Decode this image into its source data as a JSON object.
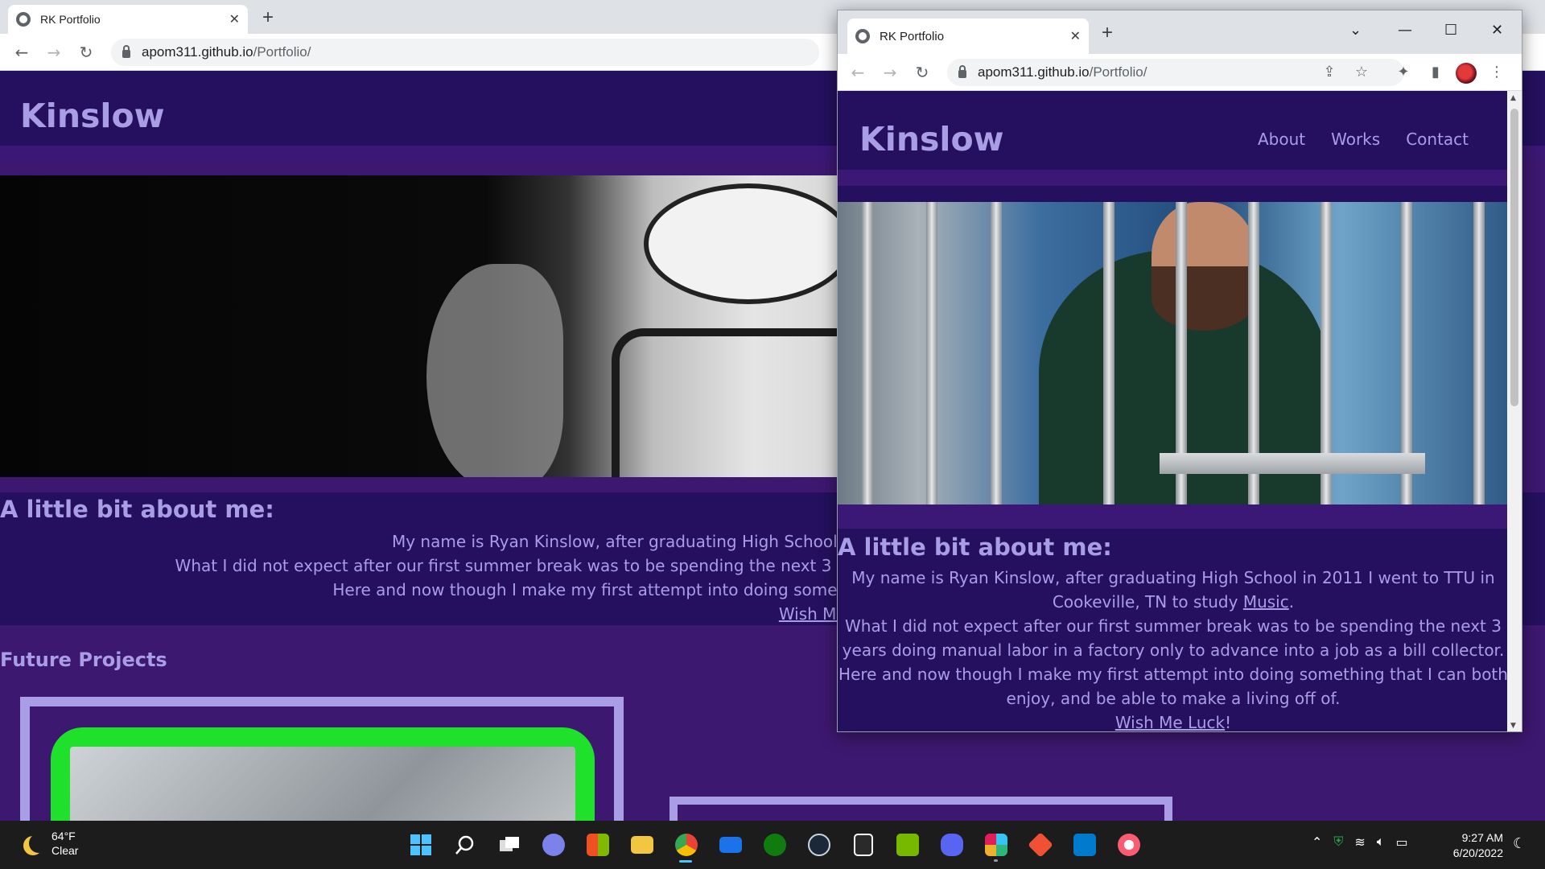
{
  "background_browser": {
    "tab_title": "RK Portfolio",
    "tab_close": "✕",
    "new_tab": "+",
    "url_host": "apom311.github.io",
    "url_path": "/Portfolio/",
    "site": {
      "logo": "Kinslow",
      "about_heading": "A little bit about me:",
      "about_line1": "My name is Ryan Kinslow, after graduating High School in 2011 I went to TTU in Cookeville, TN to study Music.",
      "about_line2": "What I did not expect after our first summer break was to be spending the next 3 years doing manual labor in a factory only to advance into a job as a bill collector.",
      "about_line3": "Here and now though I make my first attempt into doing something that I can both enjoy, and be able to make a living off of.",
      "wish_link": "Wish Me Luck",
      "wish_suffix": "!",
      "future_heading": "Future Projects"
    }
  },
  "foreground_browser": {
    "tab_title": "RK Portfolio",
    "tab_close": "✕",
    "new_tab": "+",
    "url_host": "apom311.github.io",
    "url_path": "/Portfolio/",
    "site": {
      "logo": "Kinslow",
      "nav": [
        "About",
        "Works",
        "Contact"
      ],
      "about_heading": "A little bit about me:",
      "p1_pre": "My name is Ryan Kinslow, after graduating High School in 2011 I went to TTU in Cookeville, TN to study ",
      "p1_link": "Music",
      "p1_post": ".",
      "p2": "What I did not expect after our first summer break was to be spending the next 3 years doing manual labor in a factory only to advance into a job as a bill collector.",
      "p3": "Here and now though I make my first attempt into doing something that I can both enjoy, and be able to make a living off of.",
      "wish_link": "Wish Me Luck",
      "wish_suffix": "!"
    }
  },
  "taskbar": {
    "weather_temp": "64°F",
    "weather_cond": "Clear",
    "time": "9:27 AM",
    "date": "6/20/2022",
    "apps": [
      "start",
      "search",
      "task-view",
      "teams-chat",
      "microsoft-store",
      "file-explorer",
      "chrome",
      "mail",
      "xbox",
      "steam",
      "epic-games",
      "nvidia",
      "discord",
      "slack",
      "git",
      "vs-code",
      "itunes"
    ]
  },
  "colors": {
    "site_bg": "#24105e",
    "site_band": "#3b1875",
    "site_text": "#a99ee6",
    "green_frame": "#1fe02a"
  }
}
